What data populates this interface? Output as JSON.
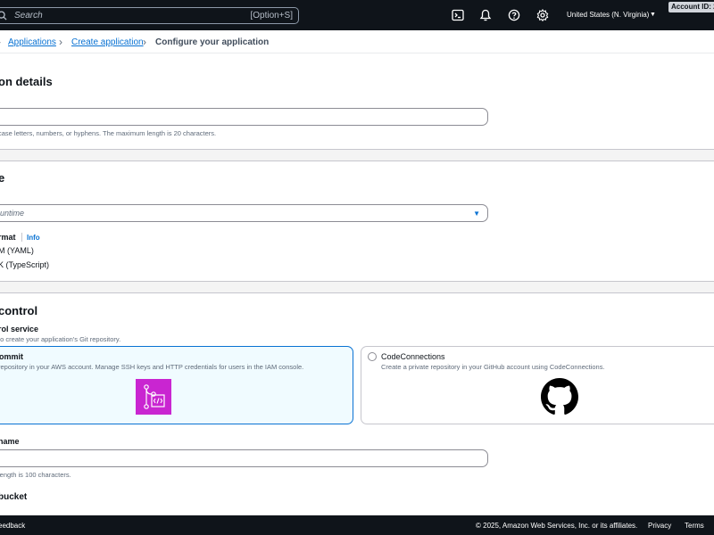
{
  "topnav": {
    "search_placeholder": "Search",
    "search_shortcut": "[Option+S]",
    "region": "United States (N. Virginia)",
    "account": "Account ID: 2",
    "icons": [
      "search-icon",
      "cloudshell-icon",
      "bell-icon",
      "help-icon",
      "gear-icon",
      "caret-down-icon"
    ]
  },
  "breadcrumb": {
    "items": [
      "Applications",
      "Create application"
    ],
    "current": "Configure your application"
  },
  "sections": {
    "details": {
      "title": "on details",
      "name_hint": "case letters, numbers, or hyphens. The maximum length is 20 characters."
    },
    "runtime": {
      "title": "e",
      "select_value": "untime",
      "format_label": "rmat",
      "info": "Info",
      "options": [
        "M (YAML)",
        "K (TypeScript)"
      ]
    },
    "source": {
      "title": "control",
      "service_label": "rol service",
      "service_desc": "to create your application's Git repository.",
      "tile1_title": "ommit",
      "tile1_desc": "repository in your AWS account. Manage SSH keys and HTTP credentials for users in the IAM console.",
      "tile2_title": "CodeConnections",
      "tile2_desc": "Create a private repository in your GitHub account using CodeConnections.",
      "repo_label": "name",
      "repo_hint": "length is 100 characters.",
      "bucket_label": "bucket"
    }
  },
  "footer": {
    "feedback": "eedback",
    "copyright": "© 2025, Amazon Web Services, Inc. or its affiliates.",
    "privacy": "Privacy",
    "terms": "Terms"
  },
  "colors": {
    "nav_bg": "#0f141a",
    "link": "#0972d3",
    "selected_tile_bg": "#f0fbff",
    "codecommit_logo": "#c925d1"
  }
}
